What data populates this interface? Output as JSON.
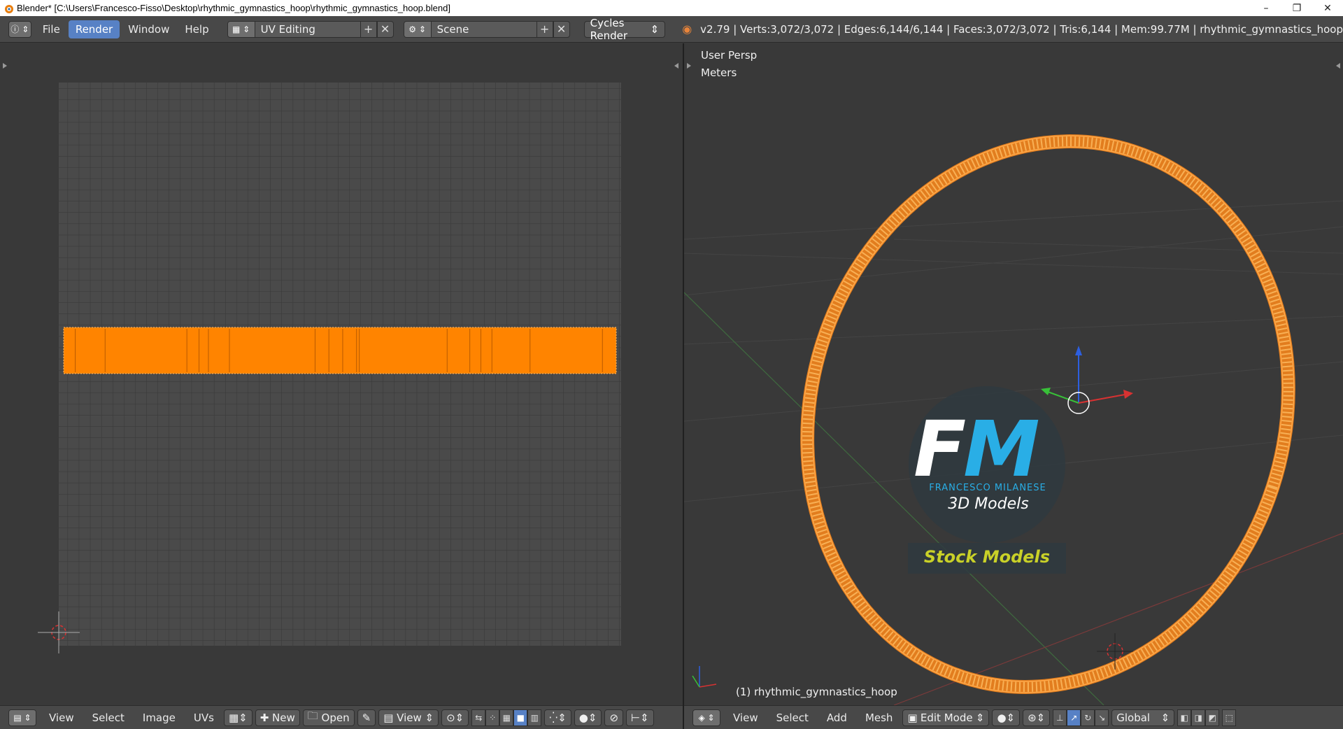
{
  "window": {
    "title": "Blender* [C:\\Users\\Francesco-Fisso\\Desktop\\rhythmic_gymnastics_hoop\\rhythmic_gymnastics_hoop.blend]",
    "minimize": "–",
    "restore": "❐",
    "close": "✕"
  },
  "info_header": {
    "menus": [
      "File",
      "Render",
      "Window",
      "Help"
    ],
    "active_menu": "Render",
    "screen_layout": "UV Editing",
    "scene": "Scene",
    "render_engine": "Cycles Render",
    "stats": "v2.79 | Verts:3,072/3,072 | Edges:6,144/6,144 | Faces:3,072/3,072 | Tris:6,144 | Mem:99.77M | rhythmic_gymnastics_hoop"
  },
  "uv_editor": {
    "footer": {
      "menus": [
        "View",
        "Select",
        "Image",
        "UVs"
      ],
      "new_label": "New",
      "open_label": "Open",
      "view_label": "View"
    },
    "uv_strip_color": "#ff8400",
    "strip_vertical_lines_fraction": [
      0.021,
      0.075,
      0.223,
      0.245,
      0.262,
      0.3,
      0.455,
      0.48,
      0.505,
      0.53,
      0.535,
      0.694,
      0.735,
      0.755,
      0.775,
      0.844,
      0.975
    ]
  },
  "viewport": {
    "view_name": "User Persp",
    "units": "Meters",
    "object_label": "(1) rhythmic_gymnastics_hoop",
    "footer": {
      "menus": [
        "View",
        "Select",
        "Add",
        "Mesh"
      ],
      "mode": "Edit Mode",
      "orientation": "Global"
    },
    "hoop_color": "#f0932e",
    "watermark": {
      "brand": "FRANCESCO MILANESE",
      "line1": "3D Models",
      "line2": "Stock Models"
    }
  },
  "colors": {
    "accent": "#5781c5",
    "panel_bg": "#393939",
    "header_bg": "#484848"
  }
}
